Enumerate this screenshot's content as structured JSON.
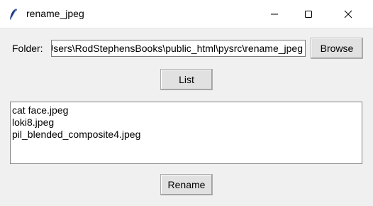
{
  "window": {
    "title": "rename_jpeg",
    "icons": {
      "app": "feather-icon",
      "minimize": "minimize-icon",
      "maximize": "maximize-icon",
      "close": "close-icon"
    }
  },
  "folder": {
    "label": "Folder:",
    "value": "C:\\Users\\RodStephensBooks\\public_html\\pysrc\\rename_jpeg"
  },
  "buttons": {
    "browse": "Browse",
    "list": "List",
    "rename": "Rename"
  },
  "files": [
    "cat face.jpeg",
    "loki8.jpeg",
    "pil_blended_composite4.jpeg"
  ]
}
